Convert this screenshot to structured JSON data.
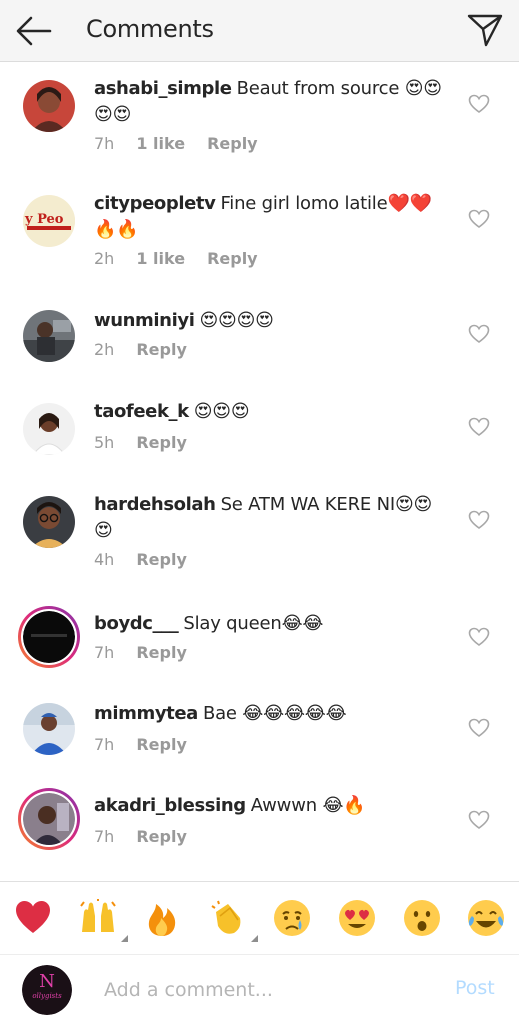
{
  "header": {
    "title": "Comments",
    "back_icon": "arrow-left-icon",
    "send_icon": "paper-plane-icon"
  },
  "comments": [
    {
      "username": "ashabi_simple",
      "text": "Beaut from source 😍😍😍😍",
      "time": "7h",
      "likes": "1 like",
      "reply": "Reply"
    },
    {
      "username": "citypeopletv",
      "text": "Fine girl lomo latile❤️❤️🔥🔥",
      "time": "2h",
      "likes": "1 like",
      "reply": "Reply"
    },
    {
      "username": "wunminiyi",
      "text": "😍😍😍😍",
      "time": "2h",
      "likes": "",
      "reply": "Reply"
    },
    {
      "username": "taofeek_k",
      "text": "😍😍😍",
      "time": "5h",
      "likes": "",
      "reply": "Reply"
    },
    {
      "username": "hardehsolah",
      "text": "Se ATM WA KERE NI😍😍😍",
      "time": "4h",
      "likes": "",
      "reply": "Reply"
    },
    {
      "username": "boydc___",
      "text": "Slay queen😂😂",
      "time": "7h",
      "likes": "",
      "reply": "Reply"
    },
    {
      "username": "mimmytea",
      "text": "Bae 😂😂😂😂😂",
      "time": "7h",
      "likes": "",
      "reply": "Reply"
    },
    {
      "username": "akadri_blessing",
      "text": "Awwwn 😂🔥",
      "time": "7h",
      "likes": "",
      "reply": "Reply"
    }
  ],
  "emoji_bar": [
    "heart",
    "raising-hands",
    "fire",
    "clapping-hands",
    "crying-face",
    "heart-eyes",
    "open-mouth",
    "tears-of-joy"
  ],
  "composer": {
    "placeholder": "Add a comment...",
    "post_label": "Post"
  },
  "colors": {
    "post_disabled": "#b3dbff",
    "story_ring_start": "#f58529",
    "story_ring_end": "#dd2a7b",
    "heart_red": "#e0245e"
  }
}
